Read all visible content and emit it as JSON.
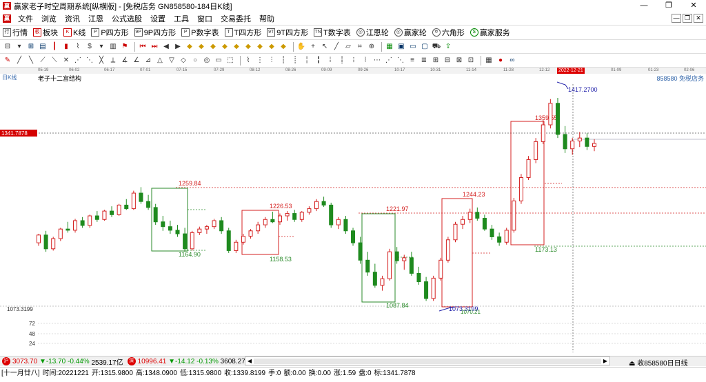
{
  "window": {
    "title": "赢家老子时空周期系统[纵横版] - [免税店务  GN858580-184日K线]",
    "controls": [
      "—",
      "❐",
      "✕"
    ]
  },
  "menu": {
    "items": [
      "文件",
      "浏览",
      "资讯",
      "江恩",
      "公式选股",
      "设置",
      "工具",
      "窗口",
      "交易委托",
      "帮助"
    ],
    "mdi": [
      "—",
      "❐",
      "✕"
    ]
  },
  "toolbar": {
    "buttons": [
      {
        "icon": "行",
        "label": "行情"
      },
      {
        "icon": "板",
        "label": "板块"
      },
      {
        "icon": "K",
        "label": "K线"
      },
      {
        "icon": "P",
        "label": "P四方形"
      },
      {
        "icon": "9P",
        "label": "9P四方形"
      },
      {
        "icon": "P",
        "label": "P数字表"
      },
      {
        "icon": "T",
        "label": "T四方形"
      },
      {
        "icon": "9T",
        "label": "9T四方形"
      },
      {
        "icon": "TN",
        "label": "T数字表"
      },
      {
        "icon": "◎",
        "label": "江恩轮"
      },
      {
        "icon": "◎",
        "label": "赢家轮"
      },
      {
        "icon": "✡",
        "label": "六角形"
      },
      {
        "icon": "$",
        "label": "赢家服务"
      }
    ]
  },
  "date_axis": {
    "labels": [
      "05-19",
      "06-02",
      "06-17",
      "07-01",
      "07-15",
      "07-29",
      "08-12",
      "08-26",
      "09-09",
      "09-26",
      "10-17",
      "10-31",
      "11-14",
      "11-28",
      "12-12",
      "01-09",
      "01-23",
      "02-06"
    ],
    "current": "2022-12-21"
  },
  "chart": {
    "period_label": "日K线",
    "indicator_name": "老子十二宫结构",
    "symbol_label": "858580 免税店务",
    "current_price_tag": "1341.7878",
    "left_scale_labels": [
      "1073.3199",
      "72",
      "48",
      "24"
    ],
    "price_levels": [
      {
        "label": "1417.2700",
        "price": 1417.27
      },
      {
        "label": "1359.55",
        "price": 1359.55
      },
      {
        "label": "1259.84",
        "price": 1259.84
      },
      {
        "label": "1244.23",
        "price": 1244.23
      },
      {
        "label": "1226.53",
        "price": 1226.53
      },
      {
        "label": "1221.97",
        "price": 1221.97
      },
      {
        "label": "1173.13",
        "price": 1173.13
      },
      {
        "label": "1164.90",
        "price": 1164.9
      },
      {
        "label": "1158.53",
        "price": 1158.53
      },
      {
        "label": "1087.84",
        "price": 1087.84
      },
      {
        "label": "1073.3199",
        "price": 1073.32
      },
      {
        "label": "1070.21",
        "price": 1070.21
      }
    ],
    "colors": {
      "up": "#d42020",
      "down": "#1e8a1e",
      "accent": "#d00000",
      "mark": "#2222aa"
    }
  },
  "chart_data": {
    "type": "candlestick",
    "title": "",
    "xlabel": "",
    "ylabel": "",
    "ylim": [
      1060,
      1440
    ],
    "candles": [
      [
        1175,
        1190,
        1170,
        1188
      ],
      [
        1188,
        1195,
        1160,
        1165
      ],
      [
        1165,
        1185,
        1162,
        1182
      ],
      [
        1182,
        1200,
        1178,
        1198
      ],
      [
        1198,
        1210,
        1192,
        1196
      ],
      [
        1196,
        1215,
        1192,
        1212
      ],
      [
        1212,
        1218,
        1200,
        1204
      ],
      [
        1204,
        1222,
        1200,
        1220
      ],
      [
        1220,
        1228,
        1210,
        1214
      ],
      [
        1214,
        1230,
        1212,
        1228
      ],
      [
        1228,
        1236,
        1218,
        1222
      ],
      [
        1222,
        1240,
        1220,
        1238
      ],
      [
        1238,
        1248,
        1230,
        1232
      ],
      [
        1232,
        1262,
        1230,
        1258
      ],
      [
        1258,
        1268,
        1240,
        1244
      ],
      [
        1244,
        1255,
        1230,
        1234
      ],
      [
        1234,
        1240,
        1205,
        1210
      ],
      [
        1210,
        1220,
        1195,
        1202
      ],
      [
        1202,
        1212,
        1190,
        1196
      ],
      [
        1196,
        1205,
        1185,
        1190
      ],
      [
        1190,
        1200,
        1160,
        1165
      ],
      [
        1165,
        1195,
        1162,
        1192
      ],
      [
        1192,
        1202,
        1188,
        1198
      ],
      [
        1198,
        1205,
        1190,
        1202
      ],
      [
        1202,
        1215,
        1198,
        1212
      ],
      [
        1212,
        1218,
        1190,
        1195
      ],
      [
        1195,
        1200,
        1158,
        1162
      ],
      [
        1162,
        1180,
        1158,
        1176
      ],
      [
        1176,
        1190,
        1172,
        1186
      ],
      [
        1186,
        1198,
        1182,
        1195
      ],
      [
        1195,
        1210,
        1190,
        1205
      ],
      [
        1205,
        1218,
        1200,
        1214
      ],
      [
        1214,
        1227,
        1208,
        1210
      ],
      [
        1210,
        1224,
        1205,
        1220
      ],
      [
        1220,
        1228,
        1212,
        1224
      ],
      [
        1224,
        1230,
        1210,
        1214
      ],
      [
        1214,
        1228,
        1210,
        1226
      ],
      [
        1226,
        1236,
        1222,
        1232
      ],
      [
        1232,
        1248,
        1228,
        1244
      ],
      [
        1244,
        1252,
        1235,
        1238
      ],
      [
        1238,
        1242,
        1200,
        1205
      ],
      [
        1205,
        1218,
        1198,
        1214
      ],
      [
        1214,
        1220,
        1190,
        1195
      ],
      [
        1195,
        1200,
        1170,
        1175
      ],
      [
        1175,
        1185,
        1140,
        1146
      ],
      [
        1146,
        1160,
        1120,
        1126
      ],
      [
        1126,
        1140,
        1100,
        1104
      ],
      [
        1104,
        1120,
        1095,
        1115
      ],
      [
        1115,
        1165,
        1112,
        1160
      ],
      [
        1160,
        1168,
        1140,
        1145
      ],
      [
        1145,
        1155,
        1130,
        1150
      ],
      [
        1150,
        1160,
        1120,
        1124
      ],
      [
        1124,
        1135,
        1105,
        1110
      ],
      [
        1110,
        1118,
        1078,
        1082
      ],
      [
        1082,
        1120,
        1078,
        1116
      ],
      [
        1116,
        1150,
        1112,
        1146
      ],
      [
        1146,
        1185,
        1142,
        1180
      ],
      [
        1180,
        1210,
        1176,
        1206
      ],
      [
        1206,
        1220,
        1198,
        1214
      ],
      [
        1214,
        1232,
        1208,
        1226
      ],
      [
        1226,
        1234,
        1212,
        1216
      ],
      [
        1216,
        1222,
        1195,
        1198
      ],
      [
        1198,
        1205,
        1180,
        1185
      ],
      [
        1185,
        1192,
        1170,
        1176
      ],
      [
        1176,
        1200,
        1172,
        1196
      ],
      [
        1196,
        1250,
        1192,
        1245
      ],
      [
        1245,
        1290,
        1240,
        1284
      ],
      [
        1284,
        1320,
        1280,
        1314
      ],
      [
        1314,
        1350,
        1308,
        1344
      ],
      [
        1344,
        1380,
        1340,
        1372
      ],
      [
        1372,
        1415,
        1366,
        1408
      ],
      [
        1408,
        1417,
        1350,
        1356
      ],
      [
        1356,
        1370,
        1325,
        1332
      ],
      [
        1332,
        1350,
        1322,
        1345
      ],
      [
        1345,
        1360,
        1335,
        1350
      ],
      [
        1350,
        1358,
        1330,
        1336
      ],
      [
        1336,
        1348,
        1328,
        1341
      ]
    ]
  },
  "index_bar": {
    "sh": {
      "badge": "沪",
      "value": "3073.70",
      "change": "▼-13.70",
      "pct": "-0.44%",
      "amount": "2539.17亿"
    },
    "sz": {
      "badge": "深",
      "value": "10996.41",
      "change": "▼-14.12",
      "pct": "-0.13%",
      "amount": "3608.27"
    },
    "right_label": "收858580日日线"
  },
  "status": {
    "items": [
      "[十一月廿八]",
      "时间:20221221",
      "开:1315.9800",
      "高:1348.0900",
      "低:1315.9800",
      "收:1339.8199",
      "手:0",
      "额:0.00",
      "换:0.00",
      "涨:1.59",
      "盘:0",
      "标:1341.7878"
    ]
  }
}
